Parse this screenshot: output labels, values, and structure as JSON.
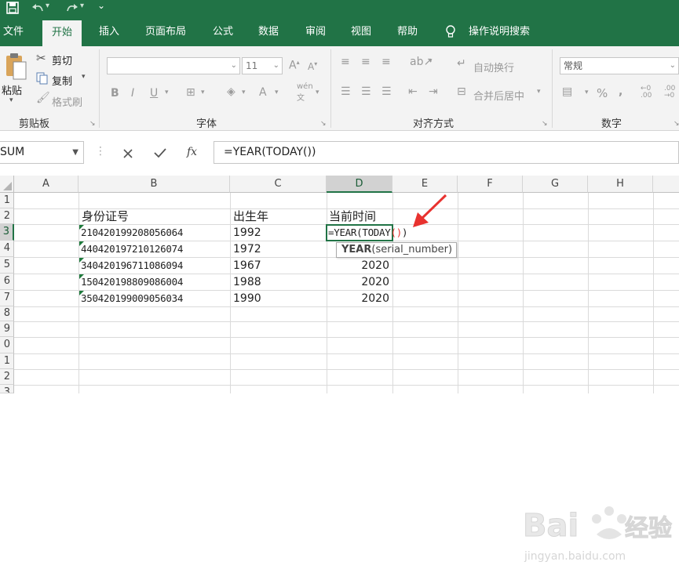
{
  "tabs": [
    "文件",
    "开始",
    "插入",
    "页面布局",
    "公式",
    "数据",
    "审阅",
    "视图",
    "帮助"
  ],
  "tell_me": "操作说明搜索",
  "clipboard": {
    "paste": "粘贴",
    "cut": "剪切",
    "copy": "复制",
    "format_painter": "格式刷",
    "label": "剪贴板"
  },
  "font": {
    "label": "字体",
    "size": "11",
    "phonetic": "wén"
  },
  "alignment": {
    "wrap_text": "自动换行",
    "merge_center": "合并后居中",
    "label": "对齐方式"
  },
  "number": {
    "format": "常规",
    "label": "数字"
  },
  "formula_bar": {
    "name_box": "SUM",
    "formula": "=YEAR(TODAY())"
  },
  "columns": [
    "A",
    "B",
    "C",
    "D",
    "E",
    "F",
    "G",
    "H"
  ],
  "rows": [
    "1",
    "2",
    "3",
    "4",
    "5",
    "6",
    "7",
    "8",
    "9",
    "0",
    "1",
    "2",
    "3"
  ],
  "headers": {
    "id": "身份证号",
    "birth_year": "出生年",
    "current_time": "当前时间"
  },
  "records": [
    {
      "id": "210420199208056064",
      "birth_year": "1992",
      "current": "=YEAR(TODAY"
    },
    {
      "id": "440420197210126074",
      "birth_year": "1972",
      "current": "2020"
    },
    {
      "id": "340420196711086094",
      "birth_year": "1967",
      "current": "2020"
    },
    {
      "id": "150420198809086004",
      "birth_year": "1988",
      "current": "2020"
    },
    {
      "id": "350420199009056034",
      "birth_year": "1990",
      "current": "2020"
    }
  ],
  "editing_parens": "()",
  "editing_close": ")",
  "tooltip": {
    "function": "YEAR",
    "args": "(serial_number)"
  },
  "colors": {
    "accent": "#217346",
    "annotation": "#e8322f",
    "text_indicator": "#1e7a3c"
  },
  "icons": [
    "save-icon",
    "undo-icon",
    "redo-icon",
    "lightbulb-icon",
    "scissors-icon",
    "copy-icon",
    "brush-icon",
    "cancel-icon",
    "enter-icon",
    "fx-icon"
  ]
}
